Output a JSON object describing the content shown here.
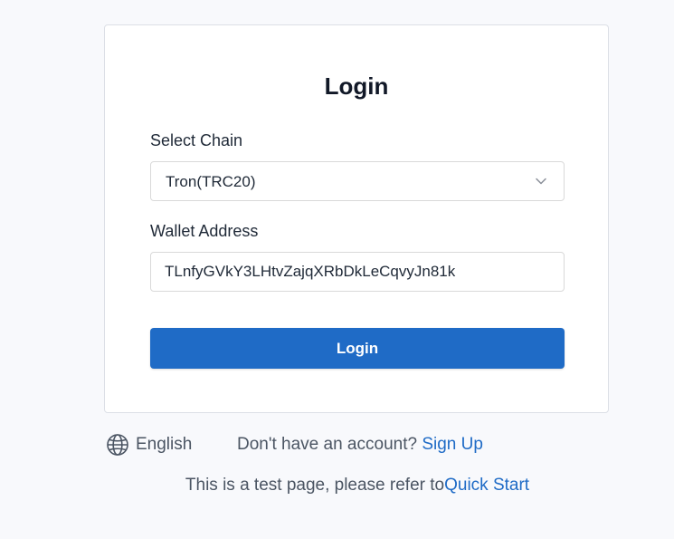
{
  "login": {
    "title": "Login",
    "chain_label": "Select Chain",
    "chain_value": "Tron(TRC20)",
    "wallet_label": "Wallet Address",
    "wallet_value": "TLnfyGVkY3LHtvZajqXRbDkLeCqvyJn81k",
    "button_label": "Login"
  },
  "footer": {
    "language": "English",
    "signup_prompt": "Don't have an account? ",
    "signup_link": "Sign Up",
    "test_note": "This is a test page, please refer to",
    "quick_start_link": "Quick Start"
  },
  "colors": {
    "accent": "#1f6bc6",
    "background": "#f8f9fc",
    "card": "#ffffff"
  },
  "icons": {
    "select": "chevron-down-icon",
    "language": "globe-icon"
  }
}
